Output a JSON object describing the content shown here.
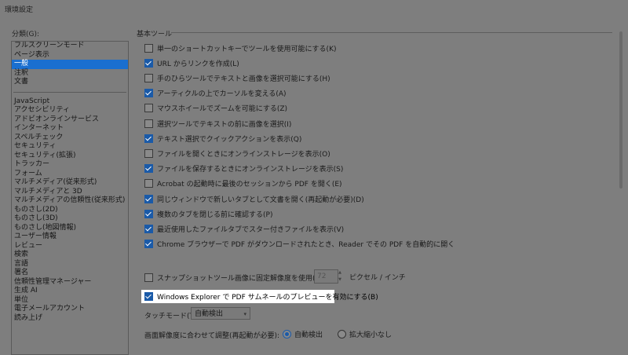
{
  "window": {
    "title": "環境設定"
  },
  "categories": {
    "label": "分類(G):",
    "group1": [
      "フルスクリーンモード",
      "ページ表示",
      "一般",
      "注釈",
      "文書"
    ],
    "selected_index": 2,
    "group2": [
      "JavaScript",
      "アクセシビリティ",
      "アドビオンラインサービス",
      "インターネット",
      "スペルチェック",
      "セキュリティ",
      "セキュリティ(拡張)",
      "トラッカー",
      "フォーム",
      "マルチメディア(従来形式)",
      "マルチメディアと 3D",
      "マルチメディアの信頼性(従来形式)",
      "ものさし(2D)",
      "ものさし(3D)",
      "ものさし(地図情報)",
      "ユーザー情報",
      "レビュー",
      "検索",
      "言語",
      "署名",
      "信頼性管理マネージャー",
      "生成 AI",
      "単位",
      "電子メールアカウント",
      "読み上げ"
    ]
  },
  "section": {
    "title": "基本ツール"
  },
  "options": [
    {
      "label": "単一のショートカットキーでツールを使用可能にする(K)",
      "checked": false
    },
    {
      "label": "URL からリンクを作成(L)",
      "checked": true
    },
    {
      "label": "手のひらツールでテキストと画像を選択可能にする(H)",
      "checked": false
    },
    {
      "label": "アーティクルの上でカーソルを変える(A)",
      "checked": true
    },
    {
      "label": "マウスホイールでズームを可能にする(Z)",
      "checked": false
    },
    {
      "label": "選択ツールでテキストの前に画像を選択(I)",
      "checked": false
    },
    {
      "label": "テキスト選択でクイックアクションを表示(Q)",
      "checked": true
    },
    {
      "label": "ファイルを開くときにオンラインストレージを表示(O)",
      "checked": false
    },
    {
      "label": "ファイルを保存するときにオンラインストレージを表示(S)",
      "checked": true
    },
    {
      "label": "Acrobat の起動時に最後のセッションから PDF を開く(E)",
      "checked": false
    },
    {
      "label": "同じウィンドウで新しいタブとして文書を開く(再起動が必要)(D)",
      "checked": true
    },
    {
      "label": "複数のタブを閉じる前に確認する(P)",
      "checked": true
    },
    {
      "label": "最近使用したファイルタブでスター付きファイルを表示(V)",
      "checked": true
    },
    {
      "label": "Chrome ブラウザーで PDF がダウンロードされたとき、Reader でその PDF を自動的に開く",
      "checked": true
    }
  ],
  "snapshot": {
    "label": "スナップショットツール画像に固定解像度を使用(N):",
    "checked": false,
    "value": "72",
    "unit": "ピクセル / インチ"
  },
  "explorer_preview": {
    "label": "Windows Explorer で PDF サムネールのプレビューを有効にする(B)",
    "checked": true
  },
  "touch_mode": {
    "label": "タッチモード(T):",
    "value": "自動検出"
  },
  "resolution": {
    "label": "画面解像度に合わせて調整(再起動が必要):",
    "options": [
      "自動検出",
      "拡大縮小なし"
    ],
    "selected": 0
  },
  "colors": {
    "dim": "#7e7e7e",
    "accent": "#1a5aa8",
    "selection": "#1a6fd0",
    "highlight": "#ffffff"
  }
}
